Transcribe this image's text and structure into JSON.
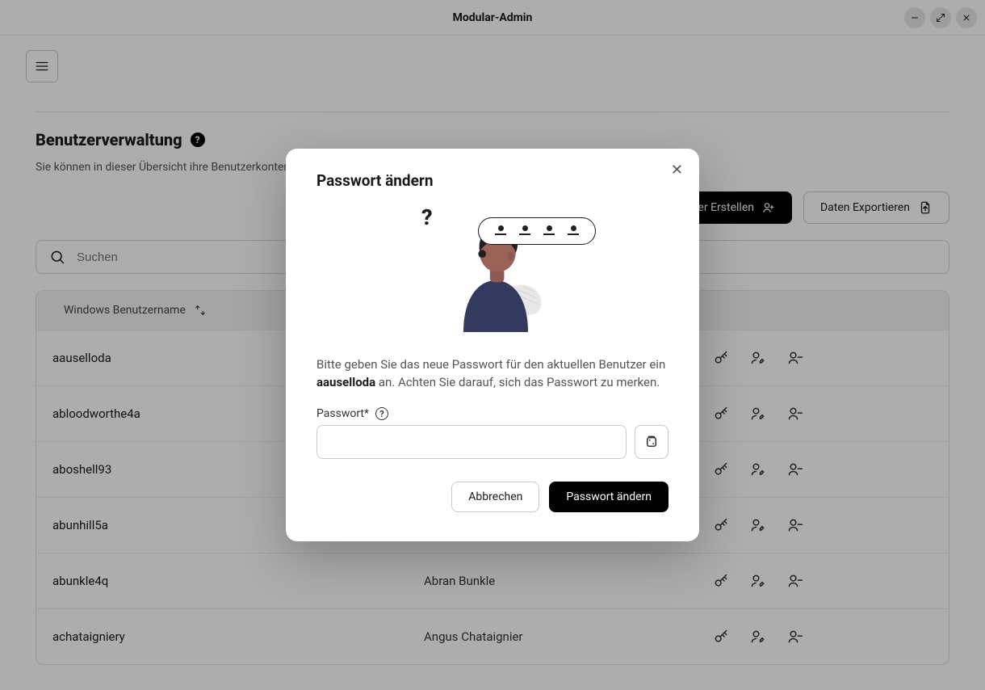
{
  "window": {
    "title": "Modular-Admin"
  },
  "page": {
    "title": "Benutzerverwaltung",
    "subtitle": "Sie können in dieser Übersicht ihre Benutzerkonten administrieren. Verwenden Sie dazu einfach die unten aufgeführte Tabelle."
  },
  "actions": {
    "create_user": "Benutzer Erstellen",
    "export_data": "Daten Exportieren"
  },
  "search": {
    "placeholder": "Suchen"
  },
  "table": {
    "header_username": "Windows Benutzername",
    "rows": [
      {
        "username": "aauselloda",
        "display_name": ""
      },
      {
        "username": "abloodworthe4a",
        "display_name": ""
      },
      {
        "username": "aboshell93",
        "display_name": ""
      },
      {
        "username": "abunhill5a",
        "display_name": ""
      },
      {
        "username": "abunkle4q",
        "display_name": "Abran Bunkle"
      },
      {
        "username": "achataigniery",
        "display_name": "Angus Chataignier"
      }
    ]
  },
  "modal": {
    "title": "Passwort ändern",
    "desc_prefix": "Bitte geben Sie das neue Passwort für den aktuellen Benutzer ein ",
    "desc_user": "aauselloda",
    "desc_suffix": " an. Achten Sie darauf, sich das Passwort zu merken.",
    "password_label": "Passwort*",
    "cancel": "Abbrechen",
    "submit": "Passwort ändern"
  }
}
